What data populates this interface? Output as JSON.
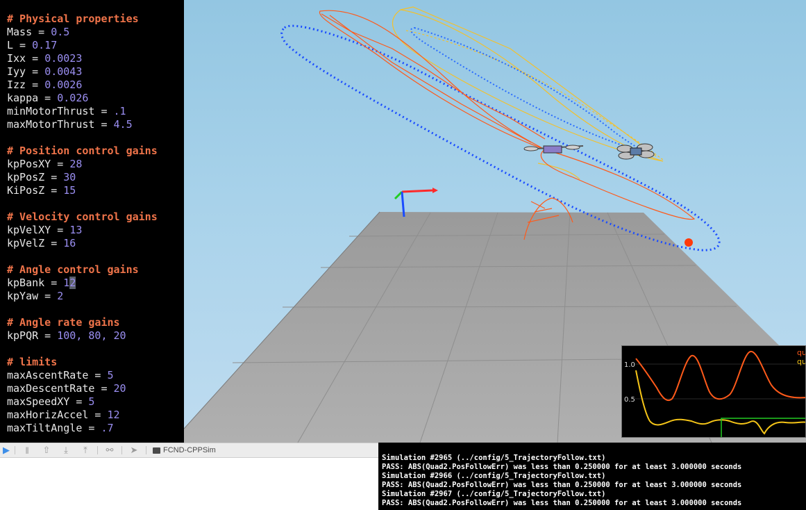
{
  "editor": {
    "lines": [
      {
        "type": "comment",
        "text": "# Physical properties"
      },
      {
        "type": "assign",
        "key": "Mass",
        "value": "0.5"
      },
      {
        "type": "assign",
        "key": "L",
        "value": "0.17"
      },
      {
        "type": "assign",
        "key": "Ixx",
        "value": "0.0023"
      },
      {
        "type": "assign",
        "key": "Iyy",
        "value": "0.0043"
      },
      {
        "type": "assign",
        "key": "Izz",
        "value": "0.0026"
      },
      {
        "type": "assign",
        "key": "kappa",
        "value": "0.026"
      },
      {
        "type": "assign",
        "key": "minMotorThrust",
        "value": ".1"
      },
      {
        "type": "assign",
        "key": "maxMotorThrust",
        "value": "4.5"
      },
      {
        "type": "blank"
      },
      {
        "type": "comment",
        "text": "# Position control gains"
      },
      {
        "type": "assign",
        "key": "kpPosXY",
        "value": "28"
      },
      {
        "type": "assign",
        "key": "kpPosZ",
        "value": "30"
      },
      {
        "type": "assign",
        "key": "KiPosZ",
        "value": "15"
      },
      {
        "type": "blank"
      },
      {
        "type": "comment",
        "text": "# Velocity control gains"
      },
      {
        "type": "assign",
        "key": "kpVelXY",
        "value": "13"
      },
      {
        "type": "assign",
        "key": "kpVelZ",
        "value": "16"
      },
      {
        "type": "blank"
      },
      {
        "type": "comment",
        "text": "# Angle control gains"
      },
      {
        "type": "assign",
        "key": "kpBank",
        "value": "12",
        "cursor": true
      },
      {
        "type": "assign",
        "key": "kpYaw",
        "value": "2"
      },
      {
        "type": "blank"
      },
      {
        "type": "comment",
        "text": "# Angle rate gains"
      },
      {
        "type": "assign",
        "key": "kpPQR",
        "value": "100, 80, 20"
      },
      {
        "type": "blank"
      },
      {
        "type": "comment",
        "text": "# limits"
      },
      {
        "type": "assign",
        "key": "maxAscentRate",
        "value": "5"
      },
      {
        "type": "assign",
        "key": "maxDescentRate",
        "value": "20"
      },
      {
        "type": "assign",
        "key": "maxSpeedXY",
        "value": "5"
      },
      {
        "type": "assign",
        "key": "maxHorizAccel",
        "value": "12"
      },
      {
        "type": "assign",
        "key": "maxTiltAngle",
        "value": ".7"
      }
    ]
  },
  "toolbar": {
    "buttons": [
      {
        "name": "breakpoint-icon",
        "glyph": "▶"
      },
      {
        "name": "pause-icon",
        "glyph": "‖"
      },
      {
        "name": "step-over-icon",
        "glyph": "⇧"
      },
      {
        "name": "step-into-icon",
        "glyph": "⤓"
      },
      {
        "name": "step-out-icon",
        "glyph": "⤒"
      },
      {
        "name": "debug-view-icon",
        "glyph": "⚯"
      },
      {
        "name": "location-icon",
        "glyph": "➤"
      }
    ],
    "scheme": "FCND-CPPSim"
  },
  "console": {
    "lines": [
      "Simulation #2965 (../config/5_TrajectoryFollow.txt)",
      "PASS: ABS(Quad2.PosFollowErr) was less than 0.250000 for at least 3.000000 seconds",
      "Simulation #2966 (../config/5_TrajectoryFollow.txt)",
      "PASS: ABS(Quad2.PosFollowErr) was less than 0.250000 for at least 3.000000 seconds",
      "Simulation #2967 (../config/5_TrajectoryFollow.txt)",
      "PASS: ABS(Quad2.PosFollowErr) was less than 0.250000 for at least 3.000000 seconds"
    ]
  },
  "graph": {
    "y_tick_1": "1.0",
    "y_tick_2": "0.5",
    "legend": [
      {
        "label": "qu",
        "color": "#ff5a1a"
      },
      {
        "label": "qu",
        "color": "#f5c518"
      }
    ],
    "colors": {
      "series1": "#ff5a1a",
      "series2": "#f5c518",
      "threshold": "#22cc22"
    }
  },
  "scene": {
    "colors": {
      "quad1_trail": "#ff5a1a",
      "quad2_trail": "#f2c12e",
      "reference_path": "#1a4cff",
      "x_axis": "#ff2a2a",
      "y_axis": "#22cc22",
      "z_axis": "#1a4cff",
      "floor": "#a6a6a6"
    }
  }
}
